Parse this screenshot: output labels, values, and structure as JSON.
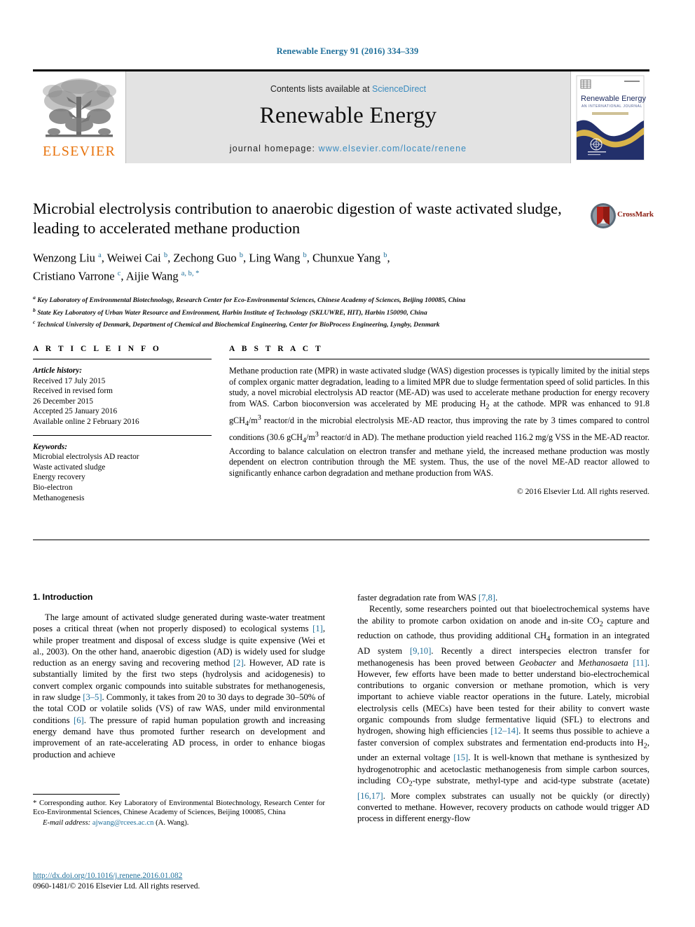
{
  "running_head": "Renewable Energy 91 (2016) 334–339",
  "masthead": {
    "publisher_name": "ELSEVIER",
    "contents_prefix": "Contents lists available at ",
    "contents_link": "ScienceDirect",
    "journal_title": "Renewable Energy",
    "homepage_prefix": "journal homepage: ",
    "homepage_url": "www.elsevier.com/locate/renene",
    "cover_title": "Renewable Energy",
    "cover_subtitle": "AN INTERNATIONAL JOURNAL"
  },
  "article": {
    "title": "Microbial electrolysis contribution to anaerobic digestion of waste activated sludge, leading to accelerated methane production",
    "crossmark_label": "CrossMark",
    "authors_line1": "Wenzong Liu a, Weiwei Cai b, Zechong Guo b, Ling Wang b, Chunxue Yang b,",
    "authors_line2": "Cristiano Varrone c, Aijie Wang a, b, *",
    "affiliations": [
      {
        "mark": "a",
        "text": "Key Laboratory of Environmental Biotechnology, Research Center for Eco-Environmental Sciences, Chinese Academy of Sciences, Beijing 100085, China"
      },
      {
        "mark": "b",
        "text": "State Key Laboratory of Urban Water Resource and Environment, Harbin Institute of Technology (SKLUWRE, HIT), Harbin 150090, China"
      },
      {
        "mark": "c",
        "text": "Technical University of Denmark, Department of Chemical and Biochemical Engineering, Center for BioProcess Engineering, Lyngby, Denmark"
      }
    ]
  },
  "article_info": {
    "heading": "A R T I C L E   I N F O",
    "history_label": "Article history:",
    "history": [
      "Received 17 July 2015",
      "Received in revised form",
      "26 December 2015",
      "Accepted 25 January 2016",
      "Available online 2 February 2016"
    ],
    "keywords_label": "Keywords:",
    "keywords": [
      "Microbial electrolysis AD reactor",
      "Waste activated sludge",
      "Energy recovery",
      "Bio-electron",
      "Methanogenesis"
    ]
  },
  "abstract": {
    "heading": "A B S T R A C T",
    "paragraph_parts": [
      "Methane production rate (MPR) in waste activated sludge (WAS) digestion processes is typically limited by the initial steps of complex organic matter degradation, leading to a limited MPR due to sludge fermentation speed of solid particles. In this study, a novel microbial electrolysis AD reactor (ME-AD) was used to accelerate methane production for energy recovery from WAS. Carbon bioconversion was accelerated by ME producing H",
      "2",
      " at the cathode. MPR was enhanced to 91.8 gCH",
      "4",
      "/m",
      "3",
      " reactor/d in the microbial electrolysis ME-AD reactor, thus improving the rate by 3 times compared to control conditions (30.6 gCH",
      "4",
      "/m",
      "3",
      " reactor/d in AD). The methane production yield reached 116.2 mg/g VSS in the ME-AD reactor. According to balance calculation on electron transfer and methane yield, the increased methane production was mostly dependent on electron contribution through the ME system. Thus, the use of the novel ME-AD reactor allowed to significantly enhance carbon degradation and methane production from WAS."
    ],
    "copyright": "© 2016 Elsevier Ltd. All rights reserved."
  },
  "body": {
    "section_heading": "1. Introduction",
    "left_paragraph_parts": [
      "The large amount of activated sludge generated during waste-water treatment poses a critical threat (when not properly disposed) to ecological systems ",
      "[1]",
      ", while proper treatment and disposal of excess sludge is quite expensive (Wei et al., 2003). On the other hand, anaerobic digestion (AD) is widely used for sludge reduction as an energy saving and recovering method ",
      "[2]",
      ". However, AD rate is substantially limited by the first two steps (hydrolysis and acidogenesis) to convert complex organic compounds into suitable substrates for methanogenesis, in raw sludge ",
      "[3–5]",
      ". Commonly, it takes from 20 to 30 days to degrade 30–50% of the total COD or volatile solids (VS) of raw WAS, under mild environmental conditions ",
      "[6]",
      ". The pressure of rapid human population growth and increasing energy demand have thus promoted further research on development and improvement of an rate-accelerating AD process, in order to enhance biogas production and achieve"
    ],
    "right_continuation": "faster degradation rate from WAS ",
    "right_continuation_ref": "[7,8]",
    "right_continuation_tail": ".",
    "right_paragraph_parts": [
      "Recently, some researchers pointed out that bioelectrochemical systems have the ability to promote carbon oxidation on anode and in-site CO",
      "2",
      " capture and reduction on cathode, thus providing additional CH",
      "4",
      " formation in an integrated AD system ",
      "[9,10]",
      ". Recently a direct interspecies electron transfer for methanogenesis has been proved between ",
      "Geobacter",
      " and ",
      "Methanosaeta",
      " ",
      "[11]",
      ". However, few efforts have been made to better understand bio-electrochemical contributions to organic conversion or methane promotion, which is very important to achieve viable reactor operations in the future. Lately, microbial electrolysis cells (MECs) have been tested for their ability to convert waste organic compounds from sludge fermentative liquid (SFL) to electrons and hydrogen, showing high efficiencies ",
      "[12–14]",
      ". It seems thus possible to achieve a faster conversion of complex substrates and fermentation end-products into H",
      "2",
      ", under an external voltage ",
      "[15]",
      ". It is well-known that methane is synthesized by hydrogenotrophic and acetoclastic methanogenesis from simple carbon sources, including CO",
      "2",
      "-type substrate, methyl-type and acid-type substrate (acetate) ",
      "[16,17]",
      ". More complex substrates can usually not be quickly (or directly) converted to methane. However, recovery products on cathode would trigger AD process in different energy-flow"
    ]
  },
  "footnote": {
    "corresponding": "* Corresponding author. Key Laboratory of Environmental Biotechnology, Research Center for Eco-Environmental Sciences, Chinese Academy of Sciences, Beijing 100085, China",
    "email_label": "E-mail address:",
    "email": "ajwang@rcees.ac.cn",
    "email_suffix": "(A. Wang)."
  },
  "footer": {
    "doi": "http://dx.doi.org/10.1016/j.renene.2016.01.082",
    "issn_line": "0960-1481/© 2016 Elsevier Ltd. All rights reserved."
  },
  "colors": {
    "link": "#1f6f9a",
    "elsevier_orange": "#e8730c",
    "masthead_bg": "#e3e3e3",
    "crossmark_red": "#8a1c10",
    "cover_navy": "#23306b",
    "cover_gold": "#d9b44a"
  }
}
